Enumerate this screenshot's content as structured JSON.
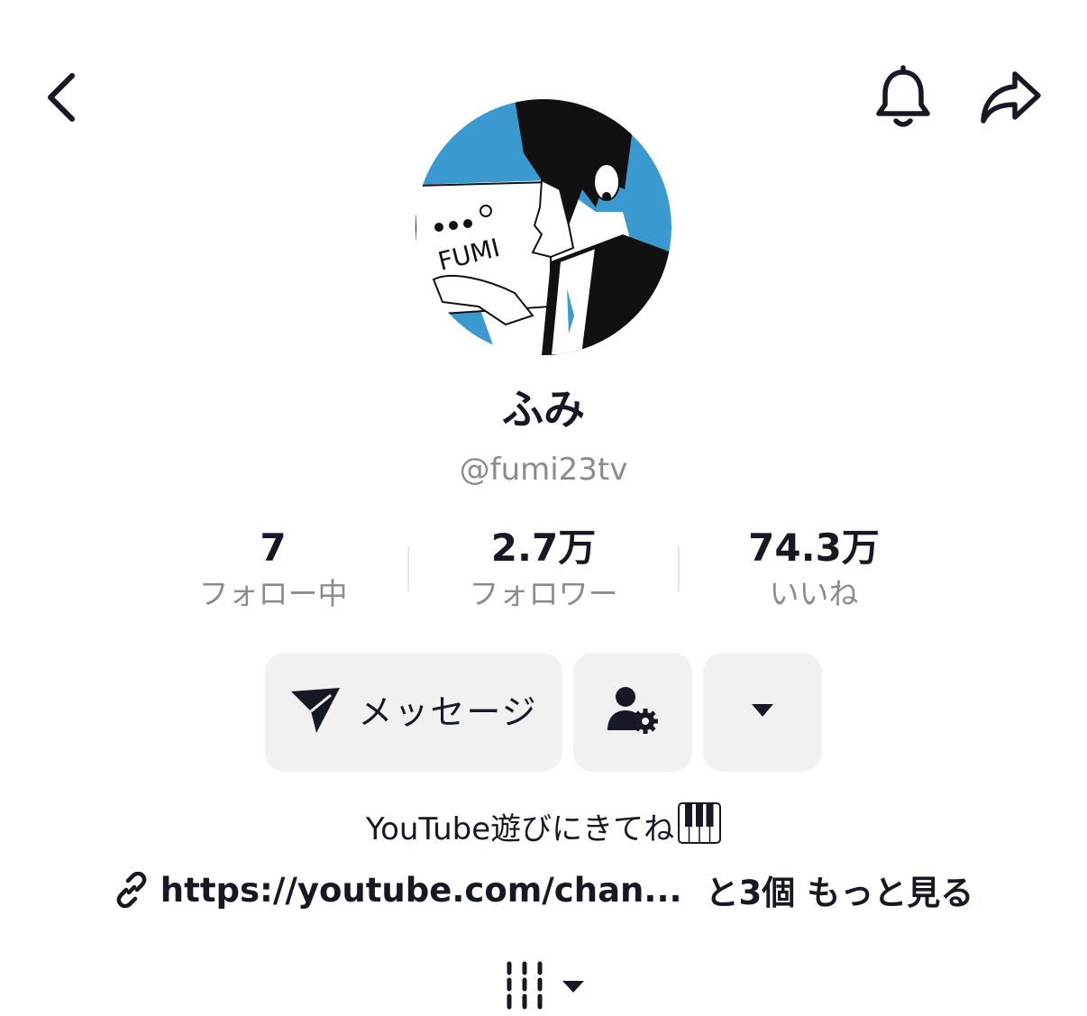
{
  "header": {
    "back_icon": "chevron-left-icon",
    "bell_icon": "bell-icon",
    "share_icon": "share-arrow-icon"
  },
  "profile": {
    "avatar_text": "FUMI",
    "avatar_colors": {
      "accent": "#3a9ad0",
      "ink": "#111111",
      "paper": "#ffffff"
    },
    "display_name": "ふみ",
    "username": "@fumi23tv"
  },
  "stats": [
    {
      "value": "7",
      "label": "フォロー中"
    },
    {
      "value": "2.7万",
      "label": "フォロワー"
    },
    {
      "value": "74.3万",
      "label": "いいね"
    }
  ],
  "actions": {
    "message_label": "メッセージ",
    "message_icon": "send-icon",
    "friend_icon": "user-gear-icon",
    "more_icon": "caret-down-icon"
  },
  "bio": {
    "text": "YouTube遊びにきてね",
    "emoji_icon": "piano-keys-icon"
  },
  "link": {
    "icon": "link-icon",
    "url": "https://youtube.com/chan...",
    "more_text": "と3個 もっと見る"
  },
  "playlist_toggle_icon": "bars-caret-icon"
}
